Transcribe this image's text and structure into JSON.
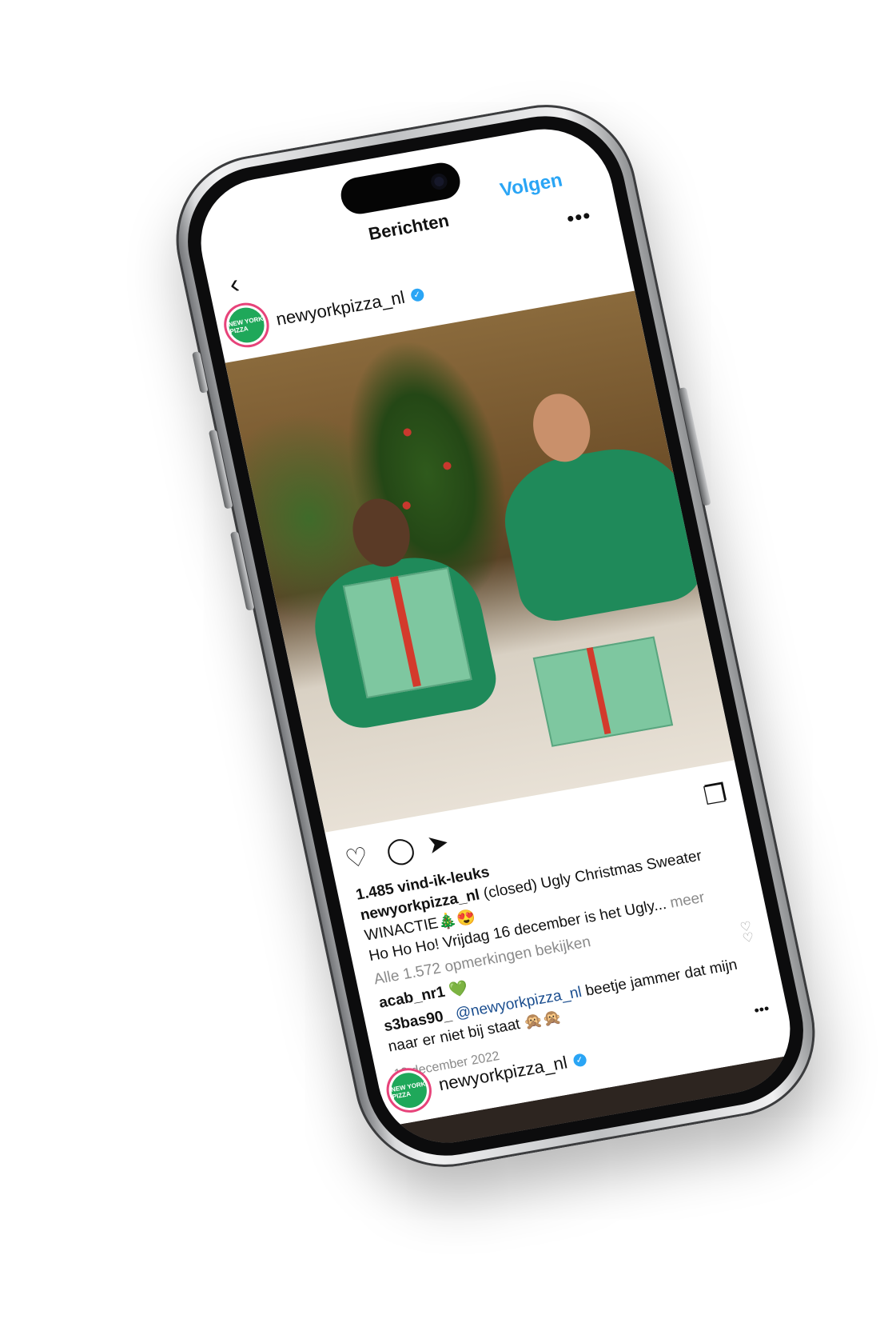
{
  "header": {
    "follow_label": "Volgen",
    "title": "Berichten",
    "back_icon": "chevron-left-icon",
    "more_icon": "more-horizontal-icon"
  },
  "post": {
    "account": {
      "username": "newyorkpizza_nl",
      "verified": true,
      "avatar_label": "NEW YORK PIZZA"
    },
    "likes": "1.485 vind-ik-leuks",
    "caption": {
      "author": "newyorkpizza_nl",
      "line1": "(closed) Ugly Christmas Sweater",
      "line2": "WINACTIE🎄😍",
      "line3": "Ho Ho Ho! Vrijdag 16 december is het Ugly...",
      "more": "meer"
    },
    "view_comments": "Alle 1.572 opmerkingen bekijken",
    "comments": [
      {
        "user": "acab_nr1",
        "text": "💚"
      },
      {
        "user": "s3bas90_",
        "mention": "@newyorkpizza_nl",
        "text": "beetje jammer dat mijn naar er niet bij staat 🙊🙊"
      }
    ],
    "date": "13 december 2022"
  },
  "next_post": {
    "username": "newyorkpizza_nl",
    "verified": true
  },
  "colors": {
    "accent": "#2aa5f5",
    "brand_green": "#1fa85a",
    "mention": "#1b4e8f"
  }
}
